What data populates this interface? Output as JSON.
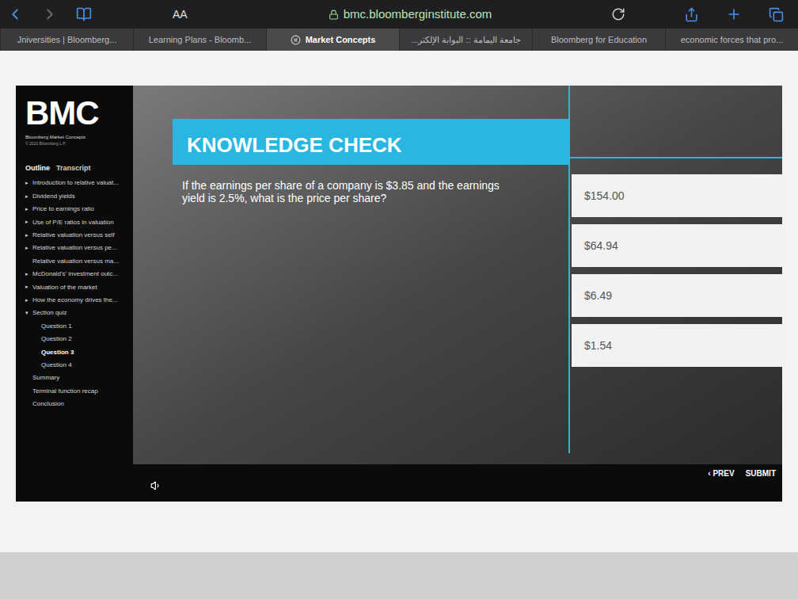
{
  "browser": {
    "text_size_button": "AA",
    "url": "bmc.bloomberginstitute.com"
  },
  "tabs": [
    {
      "label": "Jniversities | Bloomberg...",
      "selected": false
    },
    {
      "label": "Learning Plans - Bloomb...",
      "selected": false
    },
    {
      "label": "Market Concepts",
      "selected": true
    },
    {
      "label": "جامعة اليمامة :: البوابة الإلكتر...",
      "selected": false
    },
    {
      "label": "Bloomberg for Education",
      "selected": false
    },
    {
      "label": "economic forces that pro...",
      "selected": false
    }
  ],
  "app": {
    "logo": "BMC",
    "subtitle": "Bloomberg Market Concepts",
    "copyright": "© 2020 Bloomberg L.P."
  },
  "sidebar_tabs": [
    {
      "label": "Outline",
      "selected": true
    },
    {
      "label": "Transcript",
      "selected": false
    }
  ],
  "outline": [
    {
      "marker": "▸",
      "label": "Introduction to relative valuat...",
      "depth": 0,
      "selected": false
    },
    {
      "marker": "▸",
      "label": "Dividend yields",
      "depth": 0,
      "selected": false
    },
    {
      "marker": "▸",
      "label": "Price to earnings ratio",
      "depth": 0,
      "selected": false
    },
    {
      "marker": "▸",
      "label": "Use of P/E ratios in valuation",
      "depth": 0,
      "selected": false
    },
    {
      "marker": "▸",
      "label": "Relative valuation versus self",
      "depth": 0,
      "selected": false
    },
    {
      "marker": "▸",
      "label": "Relative valuation versus pe...",
      "depth": 0,
      "selected": false
    },
    {
      "marker": "",
      "label": "Relative valuation versus ma...",
      "depth": 1,
      "selected": false
    },
    {
      "marker": "▸",
      "label": "McDonald's' investment outc...",
      "depth": 0,
      "selected": false
    },
    {
      "marker": "▸",
      "label": "Valuation of the market",
      "depth": 0,
      "selected": false
    },
    {
      "marker": "▸",
      "label": "How the economy drives the...",
      "depth": 0,
      "selected": false
    },
    {
      "marker": "▾",
      "label": "Section quiz",
      "depth": 0,
      "selected": false
    },
    {
      "marker": "",
      "label": "Question 1",
      "depth": 2,
      "selected": false
    },
    {
      "marker": "",
      "label": "Question 2",
      "depth": 2,
      "selected": false
    },
    {
      "marker": "",
      "label": "Question 3",
      "depth": 2,
      "selected": true
    },
    {
      "marker": "",
      "label": "Question 4",
      "depth": 2,
      "selected": false
    },
    {
      "marker": "",
      "label": "Summary",
      "depth": 1,
      "selected": false
    },
    {
      "marker": "",
      "label": "Terminal function recap",
      "depth": 1,
      "selected": false
    },
    {
      "marker": "",
      "label": "Conclusion",
      "depth": 1,
      "selected": false
    }
  ],
  "knowledge_check": {
    "heading": "KNOWLEDGE CHECK",
    "question": "If the earnings per share of a company is $3.85 and the earnings yield is 2.5%, what is the price per share?"
  },
  "answers": [
    {
      "label": "$154.00",
      "selected": false
    },
    {
      "label": "$64.94",
      "selected": false
    },
    {
      "label": "$6.49",
      "selected": false
    },
    {
      "label": "$1.54",
      "selected": false
    }
  ],
  "nav": {
    "prev": "‹ PREV",
    "submit": "SUBMIT"
  }
}
